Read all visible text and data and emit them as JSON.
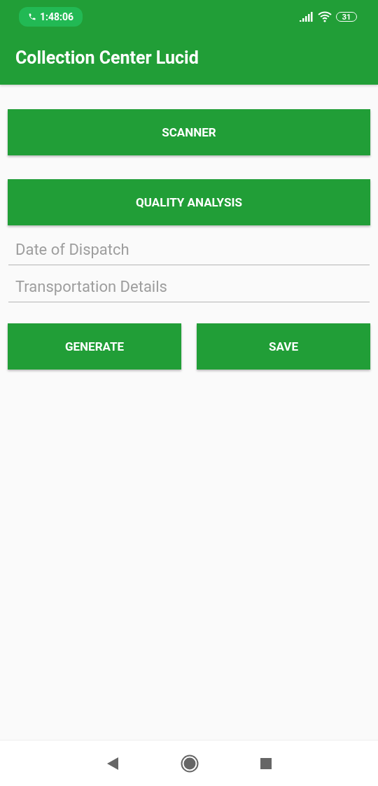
{
  "status_bar": {
    "time": "1:48:06",
    "battery": "31"
  },
  "app_bar": {
    "title": "Collection Center Lucid"
  },
  "buttons": [
    "SCANNER",
    "QUALITY ANALYSIS"
  ],
  "fields": [
    {
      "placeholder": "Date of Dispatch"
    },
    {
      "placeholder": "Transportation Details"
    }
  ],
  "actions": [
    "GENERATE",
    "SAVE"
  ]
}
